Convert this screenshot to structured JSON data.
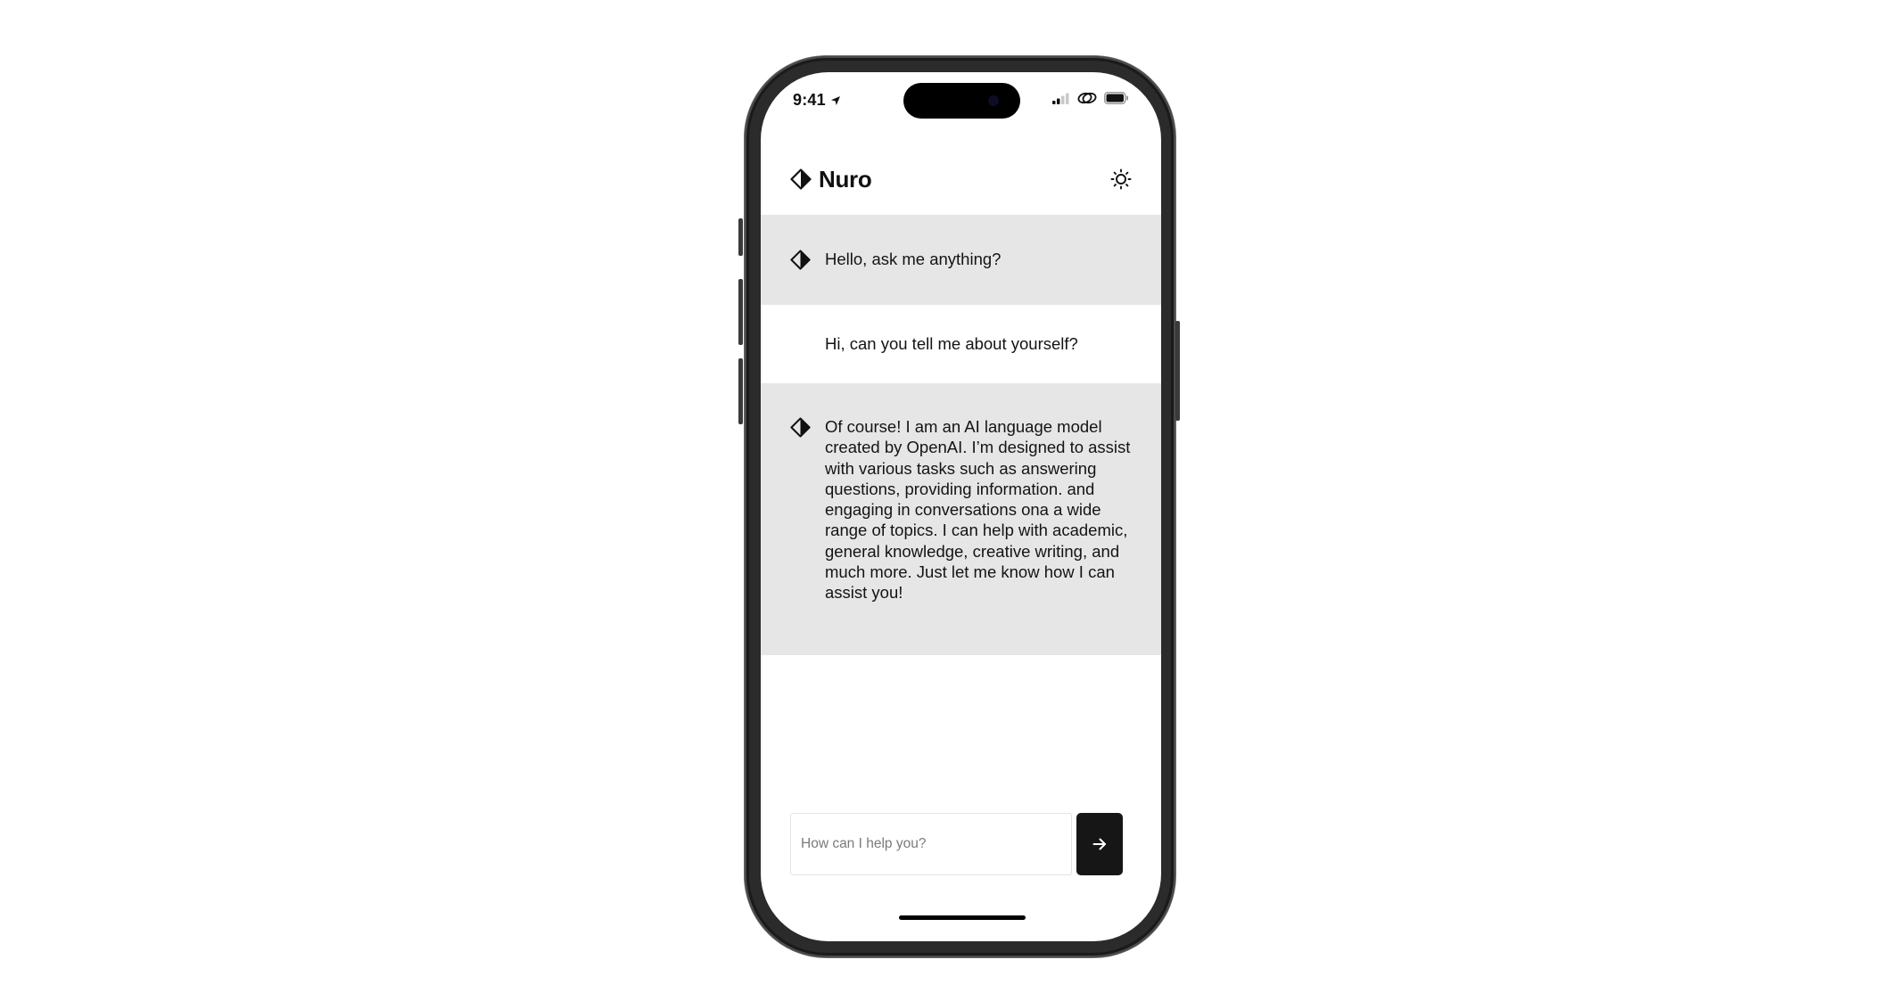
{
  "status_bar": {
    "time": "9:41",
    "icons": [
      "location-arrow-icon",
      "cellular-signal-icon",
      "wifi-icon",
      "battery-icon"
    ]
  },
  "header": {
    "brand_icon": "nuro-diamond-logo-icon",
    "title": "Nuro",
    "theme_toggle_icon": "sun-icon"
  },
  "messages": [
    {
      "role": "assistant",
      "icon": "nuro-diamond-logo-icon",
      "text": "Hello, ask me anything?"
    },
    {
      "role": "user",
      "text": "Hi, can you tell me about yourself?"
    },
    {
      "role": "assistant",
      "icon": "nuro-diamond-logo-icon",
      "text": "Of course! I am an AI language model created by OpenAI. I’m designed to assist with various tasks such as answering questions, providing information. and engaging in conversations ona a wide range of topics. I can help with academic, general knowledge, creative writing, and much more. Just let me know how I can assist you!"
    }
  ],
  "composer": {
    "placeholder": "How can I help you?",
    "value": "",
    "send_icon": "arrow-right-icon"
  },
  "colors": {
    "assistant_bubble": "#e6e6e6",
    "send_button": "#161616",
    "text": "#111111"
  }
}
